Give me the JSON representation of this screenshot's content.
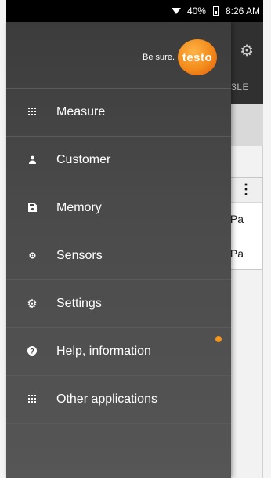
{
  "status_bar": {
    "battery": "40%",
    "time": "8:26 AM"
  },
  "app_behind": {
    "tab_fragment": "3LE",
    "values": [
      "Pa",
      "Pa"
    ]
  },
  "brand": {
    "tagline": "Be sure.",
    "logo_text": "testo",
    "accent": "#f28a1a"
  },
  "menu": [
    {
      "label": "Measure",
      "icon": "grid-icon"
    },
    {
      "label": "Customer",
      "icon": "person-icon"
    },
    {
      "label": "Memory",
      "icon": "save-icon"
    },
    {
      "label": "Sensors",
      "icon": "sensor-icon"
    },
    {
      "label": "Settings",
      "icon": "gear-icon"
    },
    {
      "label": "Help, information",
      "icon": "help-icon"
    },
    {
      "label": "Other applications",
      "icon": "grid-icon"
    }
  ],
  "notification_dot_color": "#f7941d"
}
